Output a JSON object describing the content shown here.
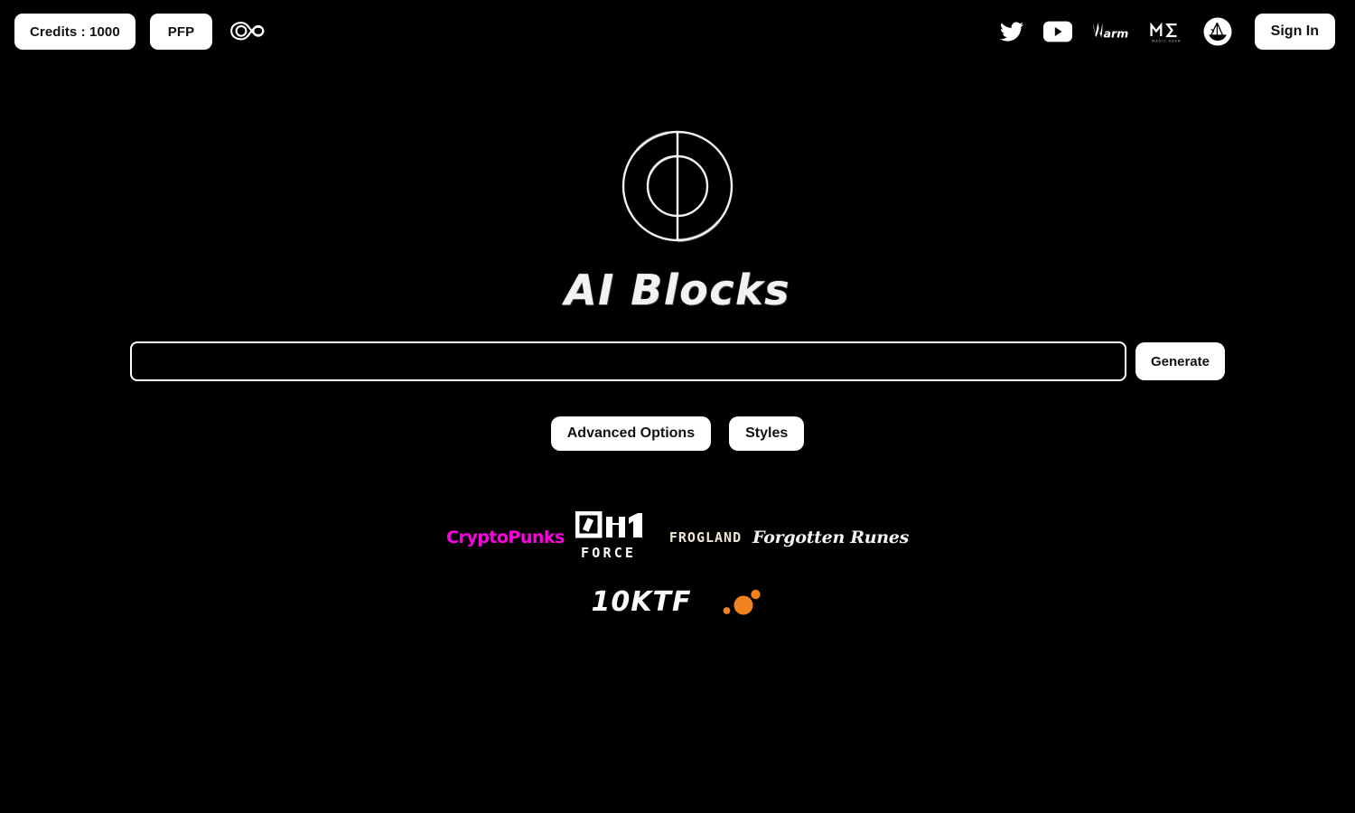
{
  "page": {
    "background_color": "#000000",
    "text_color": "#ffffff"
  },
  "topbar": {
    "credits_label": "Credits : 1000",
    "pfp_label": "PFP",
    "infinity_icon": "infinity-icon",
    "signin_label": "Sign In",
    "social_links": [
      {
        "name": "twitter-icon",
        "label": "Twitter"
      },
      {
        "name": "youtube-icon",
        "label": "YouTube"
      },
      {
        "name": "warm-icon",
        "label": "Warm"
      },
      {
        "name": "magic-eden-icon",
        "label": "Magic Eden"
      },
      {
        "name": "opensea-icon",
        "label": "OpenSea"
      }
    ],
    "magic_eden_wordmark": "MAGIC EDEN",
    "warm_wordmark": "arm"
  },
  "hero": {
    "logo_icon": "ai-blocks-circle-logo",
    "title": "AI Blocks"
  },
  "prompt": {
    "value": "",
    "placeholder": "",
    "generate_label": "Generate"
  },
  "options": {
    "advanced_label": "Advanced Options",
    "styles_label": "Styles"
  },
  "partners": {
    "row1": [
      {
        "name": "cryptopunks-logo",
        "label": "CryptoPunks",
        "color": "#ff00e0"
      },
      {
        "name": "0n1-force-logo",
        "label": "0N1",
        "sublabel": "F O R C E",
        "color": "#ffffff"
      },
      {
        "name": "frogland-logo",
        "label": "FROGLAND",
        "color": "#efe7d2"
      },
      {
        "name": "forgotten-runes-logo",
        "label": "Forgotten Runes",
        "color": "#f4f4f4"
      }
    ],
    "row2": [
      {
        "name": "10ktf-logo",
        "label": "10KTF",
        "color": "#fbfbfb"
      },
      {
        "name": "orange-dots-logo",
        "label": "",
        "color": "#f2821e"
      }
    ]
  }
}
